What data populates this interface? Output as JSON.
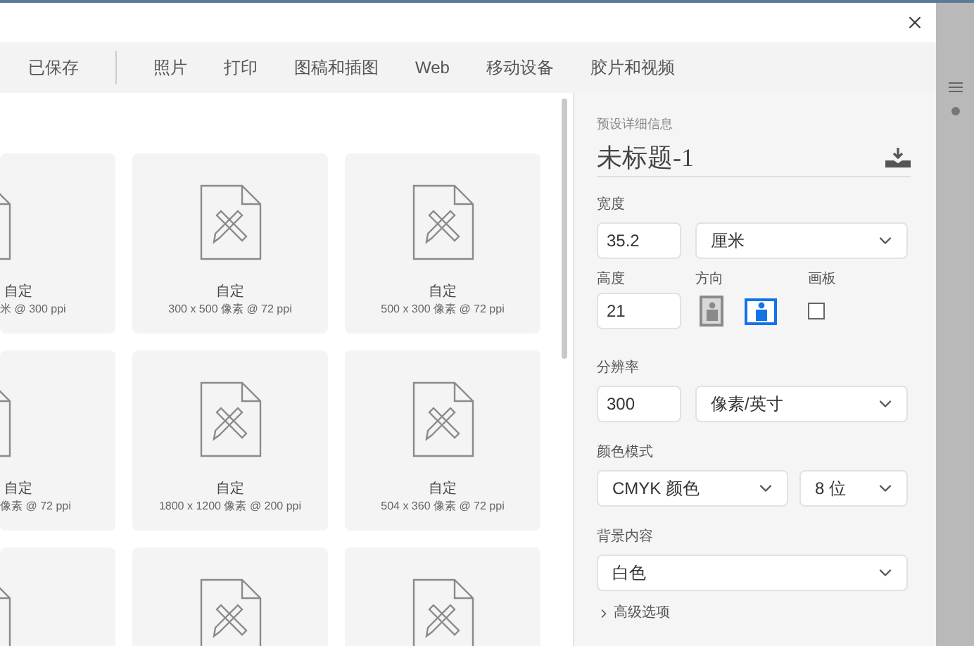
{
  "tabs": [
    {
      "label": "已保存",
      "selected": false
    },
    {
      "label": "照片",
      "selected": false
    },
    {
      "label": "打印",
      "selected": false
    },
    {
      "label": "图稿和插图",
      "selected": false
    },
    {
      "label": "Web",
      "selected": false
    },
    {
      "label": "移动设备",
      "selected": false
    },
    {
      "label": "胶片和视频",
      "selected": false
    }
  ],
  "presets": [
    [
      {
        "kind": "preset",
        "title": "自定",
        "size": "米 @ 300 ppi"
      },
      {
        "kind": "preset",
        "title": "自定",
        "size": "300 x 500 像素 @ 72 ppi"
      },
      {
        "kind": "preset",
        "title": "自定",
        "size": "500 x 300 像素 @ 72 ppi"
      }
    ],
    [
      {
        "kind": "preset",
        "title": "自定",
        "size": "像素 @ 72 ppi"
      },
      {
        "kind": "preset",
        "title": "自定",
        "size": "1800 x 1200 像素 @ 200 ppi"
      },
      {
        "kind": "preset",
        "title": "自定",
        "size": "504 x 360 像素 @ 72 ppi"
      }
    ],
    [
      {
        "kind": "blank"
      },
      {
        "kind": "blank"
      },
      {
        "kind": "blank"
      }
    ]
  ],
  "details": {
    "heading": "预设详细信息",
    "name": "未标题-1",
    "width": {
      "label": "宽度",
      "value": "35.2",
      "unit": "厘米"
    },
    "height": {
      "label": "高度",
      "value": "21"
    },
    "orientation": {
      "label": "方向",
      "options": [
        {
          "kind": "portrait",
          "selected": false
        },
        {
          "kind": "landscape",
          "selected": true
        }
      ]
    },
    "artboard": {
      "label": "画板",
      "checked": false
    },
    "resolution": {
      "label": "分辨率",
      "value": "300",
      "unit": "像素/英寸"
    },
    "color_mode": {
      "label": "颜色模式",
      "mode": "CMYK 颜色",
      "depth": "8 位"
    },
    "background": {
      "label": "背景内容",
      "value": "白色"
    },
    "advanced": {
      "label": "高级选项",
      "expanded": false
    }
  }
}
